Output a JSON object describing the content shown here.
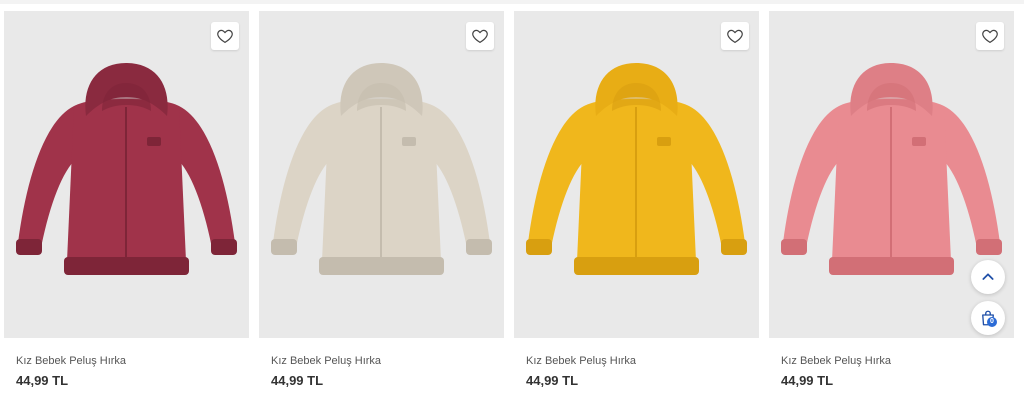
{
  "products": [
    {
      "title": "Kız Bebek Peluş Hırka",
      "price": "44,99 TL",
      "color": "#a0334a",
      "shade": "#7e2538",
      "hood": "#8a2a3f"
    },
    {
      "title": "Kız Bebek Peluş Hırka",
      "price": "44,99 TL",
      "color": "#dcd4c6",
      "shade": "#c4bcae",
      "hood": "#cfc7b9"
    },
    {
      "title": "Kız Bebek Peluş Hırka",
      "price": "44,99 TL",
      "color": "#f0b71c",
      "shade": "#d89f10",
      "hood": "#e8ad15"
    },
    {
      "title": "Kız Bebek Peluş Hırka",
      "price": "44,99 TL",
      "color": "#e98b91",
      "shade": "#d26f76",
      "hood": "#de7f86"
    }
  ],
  "icons": {
    "favorite": "heart-icon",
    "scroll_top": "chevron-up-icon",
    "cart": "shopping-bag-icon"
  },
  "colors": {
    "accent": "#2b6bd6",
    "image_bg": "#e9e9e9"
  },
  "cart": {
    "count": "0"
  }
}
